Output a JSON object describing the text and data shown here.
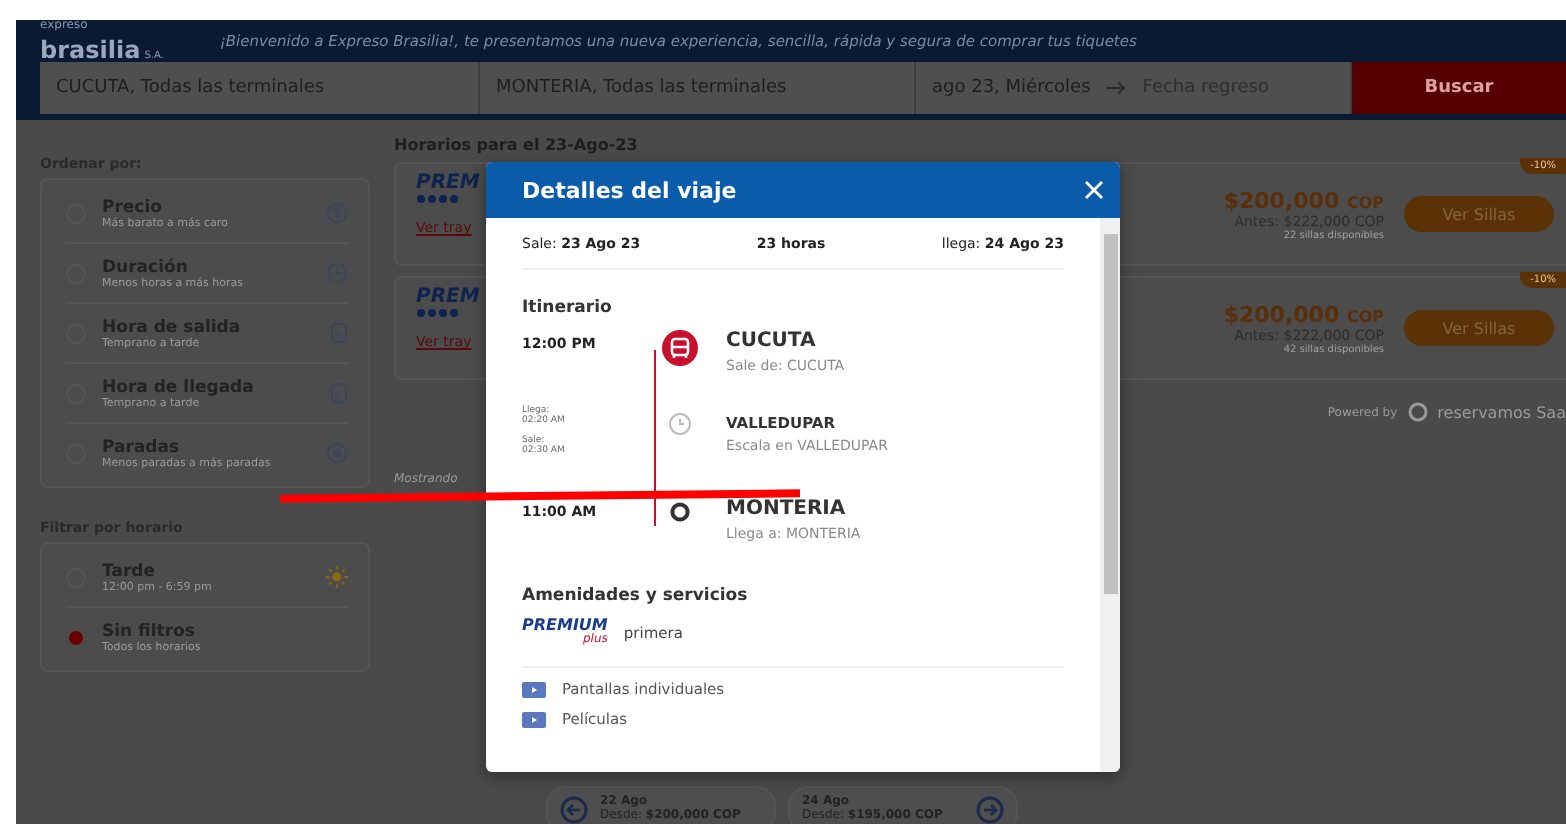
{
  "header": {
    "logo_top": "expreso",
    "logo_main": "brasilia",
    "logo_suffix": "S.A.",
    "tagline": "¡Bienvenido a Expreso Brasilia!, te presentamos una nueva experiencia, sencilla, rápida y segura de comprar tus tiquetes"
  },
  "search": {
    "origin": "CUCUTA, Todas las terminales",
    "destination": "MONTERIA, Todas las terminales",
    "date": "ago 23, Miércoles",
    "return_placeholder": "Fecha regreso",
    "button": "Buscar"
  },
  "sort": {
    "title": "Ordenar por:",
    "options": [
      {
        "label": "Precio",
        "hint": "Más barato a más caro",
        "kind": "price",
        "selected": false
      },
      {
        "label": "Duración",
        "hint": "Menos horas a más horas",
        "kind": "clock",
        "selected": false
      },
      {
        "label": "Hora de salida",
        "hint": "Temprano a tarde",
        "kind": "depart",
        "selected": false
      },
      {
        "label": "Hora de llegada",
        "hint": "Temprano a tarde",
        "kind": "arrive",
        "selected": false
      },
      {
        "label": "Paradas",
        "hint": "Menos paradas a más paradas",
        "kind": "stops",
        "selected": false
      }
    ]
  },
  "filter": {
    "title": "Filtrar por horario",
    "options": [
      {
        "label": "Tarde",
        "hint": "12:00 pm - 6:59 pm",
        "kind": "sun",
        "selected": false
      },
      {
        "label": "Sin filtros",
        "hint": "Todos los horarios",
        "kind": "none",
        "selected": true
      }
    ]
  },
  "results": {
    "title": "Horarios para el 23-Ago-23",
    "trips": [
      {
        "brand": "PREM",
        "link": "Ver tray",
        "badge": "-10%",
        "price": "$200,000",
        "currency": "COP",
        "before_label": "Antes:",
        "before": "$222,000",
        "before_currency": "COP",
        "seats": "22 sillas disponibles",
        "button": "Ver Sillas"
      },
      {
        "brand": "PREM",
        "link": "Ver tray",
        "badge": "-10%",
        "price": "$200,000",
        "currency": "COP",
        "before_label": "Antes:",
        "before": "$222,000",
        "before_currency": "COP",
        "seats": "42 sillas disponibles",
        "button": "Ver Sillas"
      }
    ],
    "showing": "Mostrando",
    "powered": "Powered by",
    "powered_brand": "reservamos Saa"
  },
  "date_nav": [
    {
      "date": "22 Ago",
      "from": "Desde:",
      "price": "$200,000 COP",
      "kind": "prev"
    },
    {
      "date": "24 Ago",
      "from": "Desde:",
      "price": "$195,000 COP",
      "kind": "next"
    }
  ],
  "modal": {
    "title": "Detalles del viaje",
    "depart_label": "Sale:",
    "depart": "23 Ago 23",
    "duration": "23 horas",
    "arrive_label": "llega:",
    "arrive": "24 Ago 23",
    "itinerary_title": "Itinerario",
    "stops": [
      {
        "kind": "origin",
        "time": "12:00 PM",
        "city": "CUCUTA",
        "note": "Sale de: CUCUTA"
      },
      {
        "kind": "stop",
        "arrive_label": "Llega:",
        "arrive_time": "02:20 AM",
        "depart_label": "Sale:",
        "depart_time": "02:30 AM",
        "city": "VALLEDUPAR",
        "note": "Escala en VALLEDUPAR"
      },
      {
        "kind": "destination",
        "time": "11:00 AM",
        "city": "MONTERIA",
        "note": "Llega a: MONTERIA"
      }
    ],
    "amenities_title": "Amenidades y servicios",
    "class_logo": "PREMIUM",
    "class_logo_script": "plus",
    "class_name": "primera",
    "amenities": [
      "Pantallas individuales",
      "Películas"
    ]
  }
}
